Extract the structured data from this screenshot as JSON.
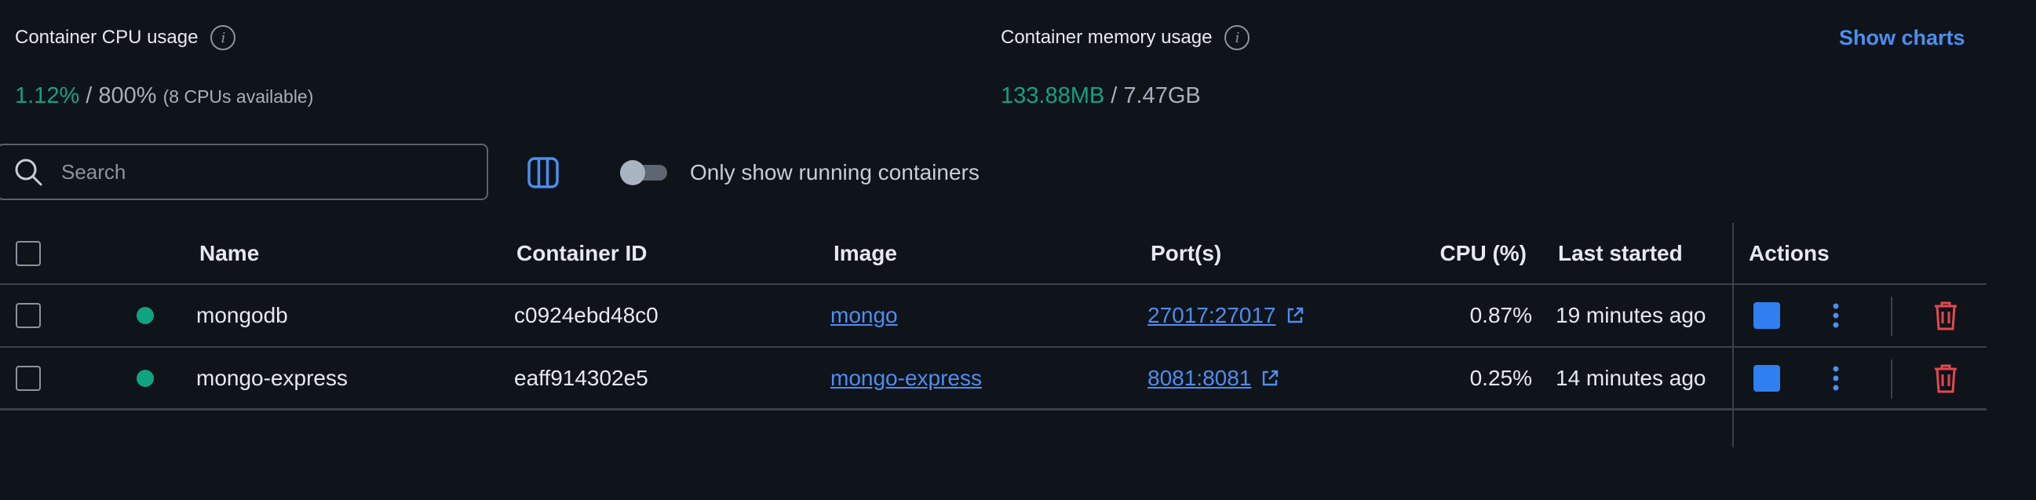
{
  "stats": {
    "cpu": {
      "title": "Container CPU usage",
      "used": "1.12%",
      "separator": " / ",
      "total": "800%",
      "note": "(8 CPUs available)"
    },
    "memory": {
      "title": "Container memory usage",
      "used": "133.88MB",
      "separator": " / ",
      "total": "7.47GB"
    },
    "show_charts_label": "Show charts"
  },
  "toolbar": {
    "search_placeholder": "Search",
    "search_value": "",
    "running_toggle_label": "Only show running containers",
    "running_toggle_on": false
  },
  "table": {
    "headers": {
      "name": "Name",
      "container_id": "Container ID",
      "image": "Image",
      "ports": "Port(s)",
      "cpu": "CPU (%)",
      "last_started": "Last started",
      "actions": "Actions"
    },
    "rows": [
      {
        "name": "mongodb",
        "container_id": "c0924ebd48c0",
        "image": "mongo",
        "ports": "27017:27017",
        "cpu": "0.87%",
        "last_started": "19 minutes ago",
        "status": "running"
      },
      {
        "name": "mongo-express",
        "container_id": "eaff914302e5",
        "image": "mongo-express",
        "ports": "8081:8081",
        "cpu": "0.25%",
        "last_started": "14 minutes ago",
        "status": "running"
      }
    ]
  },
  "colors": {
    "background": "#0f131a",
    "accent": "#4a8ff0",
    "running": "#10a37f",
    "delete": "#e5484d"
  },
  "icons": [
    "info-icon",
    "search-icon",
    "columns-icon",
    "external-link-icon",
    "stop-icon",
    "kebab-menu-icon",
    "trash-icon"
  ]
}
